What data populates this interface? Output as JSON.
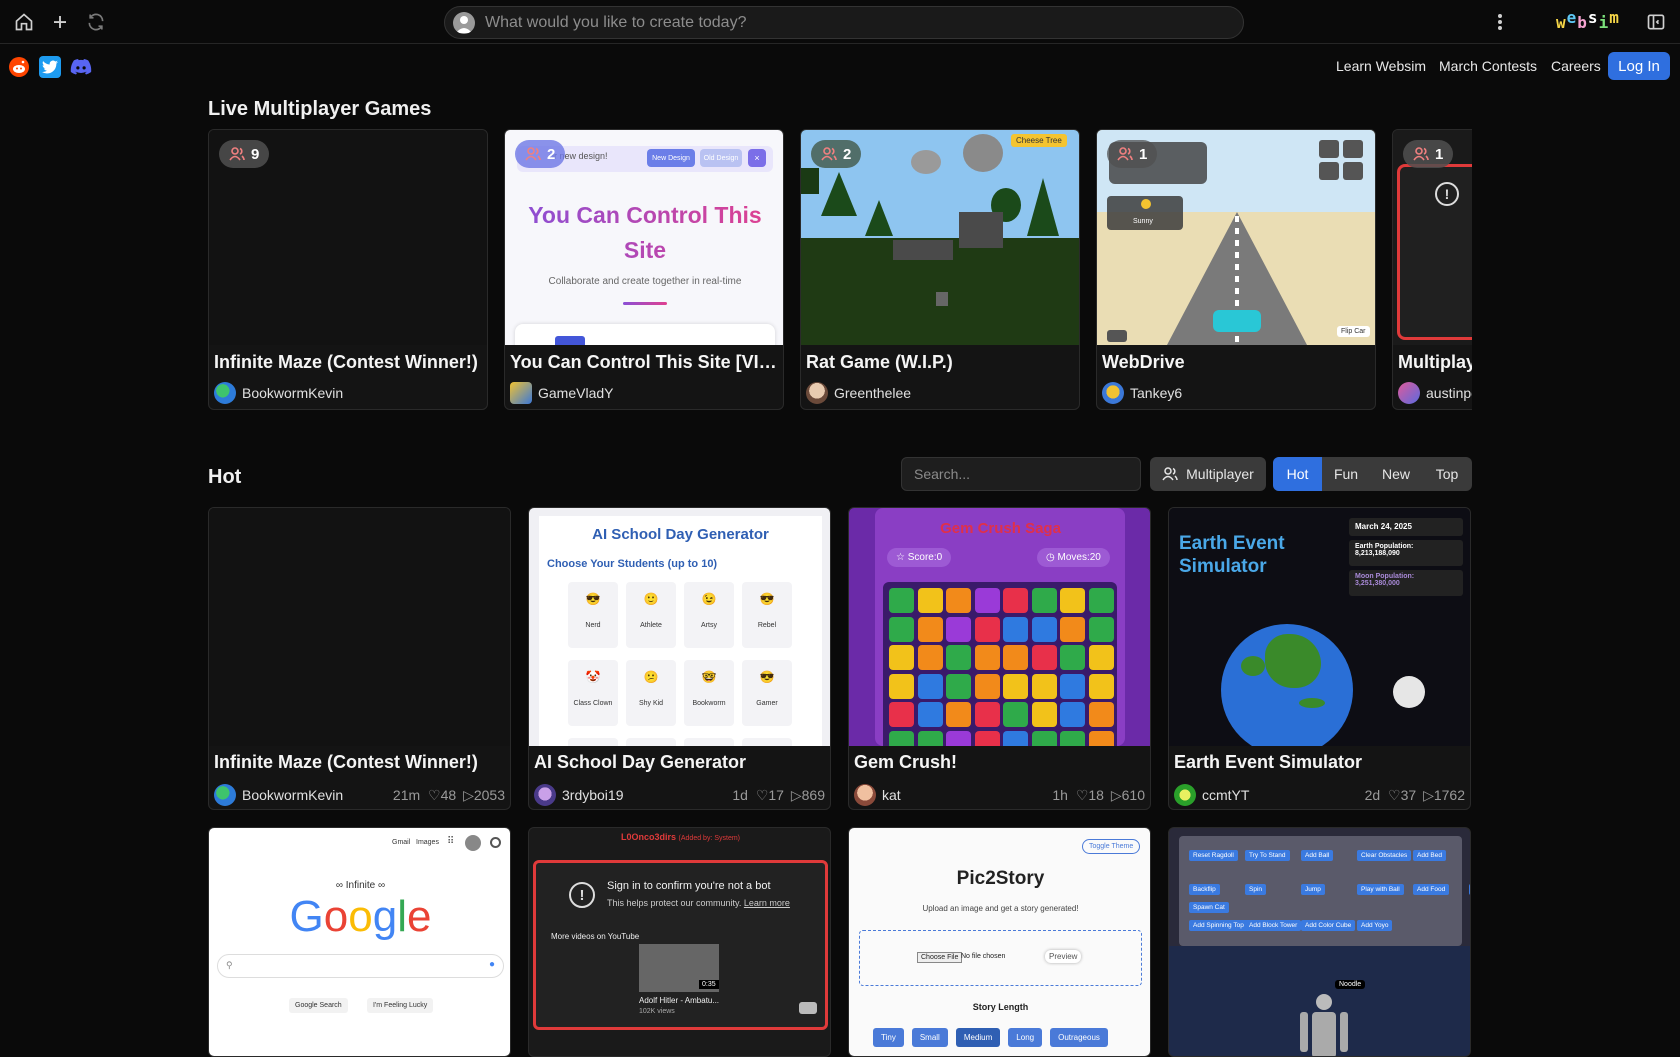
{
  "topbar": {
    "search_placeholder": "What would you like to create today?",
    "brand": [
      "w",
      "e",
      "b",
      "s",
      "i",
      "m"
    ],
    "brand_colors": [
      "#f5d547",
      "#5ec8f5",
      "#f5a3d0",
      "#ffffff",
      "#7be07b",
      "#f5d547"
    ]
  },
  "nav": {
    "learn": "Learn Websim",
    "contests": "March Contests",
    "careers": "Careers",
    "login": "Log In"
  },
  "multiplayer": {
    "title": "Live Multiplayer Games",
    "cards": [
      {
        "title": "Infinite Maze (Contest Winner!)",
        "author": "BookwormKevin",
        "count": "9"
      },
      {
        "title": "You Can Control This Site [VIDE...",
        "author": "GameVladY",
        "count": "2",
        "thumb_headline": "You Can Control This Site",
        "thumb_sub": "Collaborate and create together in real-time",
        "thumb_banner": "ur new design!",
        "thumb_btn1": "New Design",
        "thumb_btn2": "Old Design"
      },
      {
        "title": "Rat Game (W.I.P.)",
        "author": "Greenthelee",
        "count": "2",
        "thumb_btn": "Cheese Tree"
      },
      {
        "title": "WebDrive",
        "author": "Tankey6",
        "count": "1",
        "thumb_weather": "Sunny",
        "thumb_flip": "Flip Car"
      },
      {
        "title": "Multiplayer",
        "author": "austinpo",
        "count": "1"
      }
    ]
  },
  "hot": {
    "title": "Hot",
    "search_placeholder": "Search...",
    "multiplayer_label": "Multiplayer",
    "tabs": [
      "Hot",
      "Fun",
      "New",
      "Top"
    ],
    "cards": [
      {
        "title": "Infinite Maze (Contest Winner!)",
        "author": "BookwormKevin",
        "time": "21m",
        "likes": "48",
        "views": "2053"
      },
      {
        "title": "AI School Day Generator",
        "author": "3rdyboi19",
        "time": "1d",
        "likes": "17",
        "views": "869",
        "thumb_title": "AI School Day Generator",
        "thumb_sub": "Choose Your Students (up to 10)",
        "students": [
          "Nerd",
          "Athlete",
          "Artsy",
          "Rebel",
          "Class Clown",
          "Shy Kid",
          "Bookworm",
          "Gamer"
        ]
      },
      {
        "title": "Gem Crush!",
        "author": "kat",
        "time": "1h",
        "likes": "18",
        "views": "610",
        "thumb_title": "Gem Crush Saga",
        "score": "Score:0",
        "moves": "Moves:20"
      },
      {
        "title": "Earth Event Simulator",
        "author": "ccmtYT",
        "time": "2d",
        "likes": "37",
        "views": "1762",
        "thumb_title": "Earth Event Simulator",
        "date": "March 24, 2025",
        "earth_label": "Earth Population:",
        "earth_pop": "8,213,188,090",
        "moon_label": "Moon Population:",
        "moon_pop": "3,251,380,000"
      }
    ],
    "row2": [
      {
        "links": [
          "Gmail",
          "Images"
        ],
        "logo_top": "∞ Infinite ∞",
        "btn1": "Google Search",
        "btn2": "I'm Feeling Lucky"
      },
      {
        "header": "L0Onco3dirs",
        "header_note": "(Added by: System)",
        "sign_in": "Sign in to confirm you're not a bot",
        "protect": "This helps protect our community.",
        "learn_more": "Learn more",
        "more_videos": "More videos on YouTube",
        "video_title": "Adolf Hitler - Ambatu...",
        "video_views": "102K views",
        "duration": "0:35"
      },
      {
        "toggle": "Toggle Theme",
        "title": "Pic2Story",
        "sub": "Upload an image and get a story generated!",
        "choose": "Choose File",
        "no_file": "No file chosen",
        "preview": "Preview",
        "length_label": "Story Length",
        "lengths": [
          "Tiny",
          "Small",
          "Medium",
          "Long",
          "Outrageous"
        ]
      },
      {
        "buttons": [
          "Reset Ragdoll",
          "Try To Stand",
          "Add Ball",
          "Clear Obstacles",
          "Add Bed",
          "Backflip",
          "Spin",
          "Jump",
          "Play with Ball",
          "Add Food",
          "Add Water",
          "Spawn Cat",
          "Add Spinning Top",
          "Add Block Tower",
          "Add Color Cube",
          "Add Yoyo"
        ],
        "noodle": "Noodle"
      }
    ]
  }
}
